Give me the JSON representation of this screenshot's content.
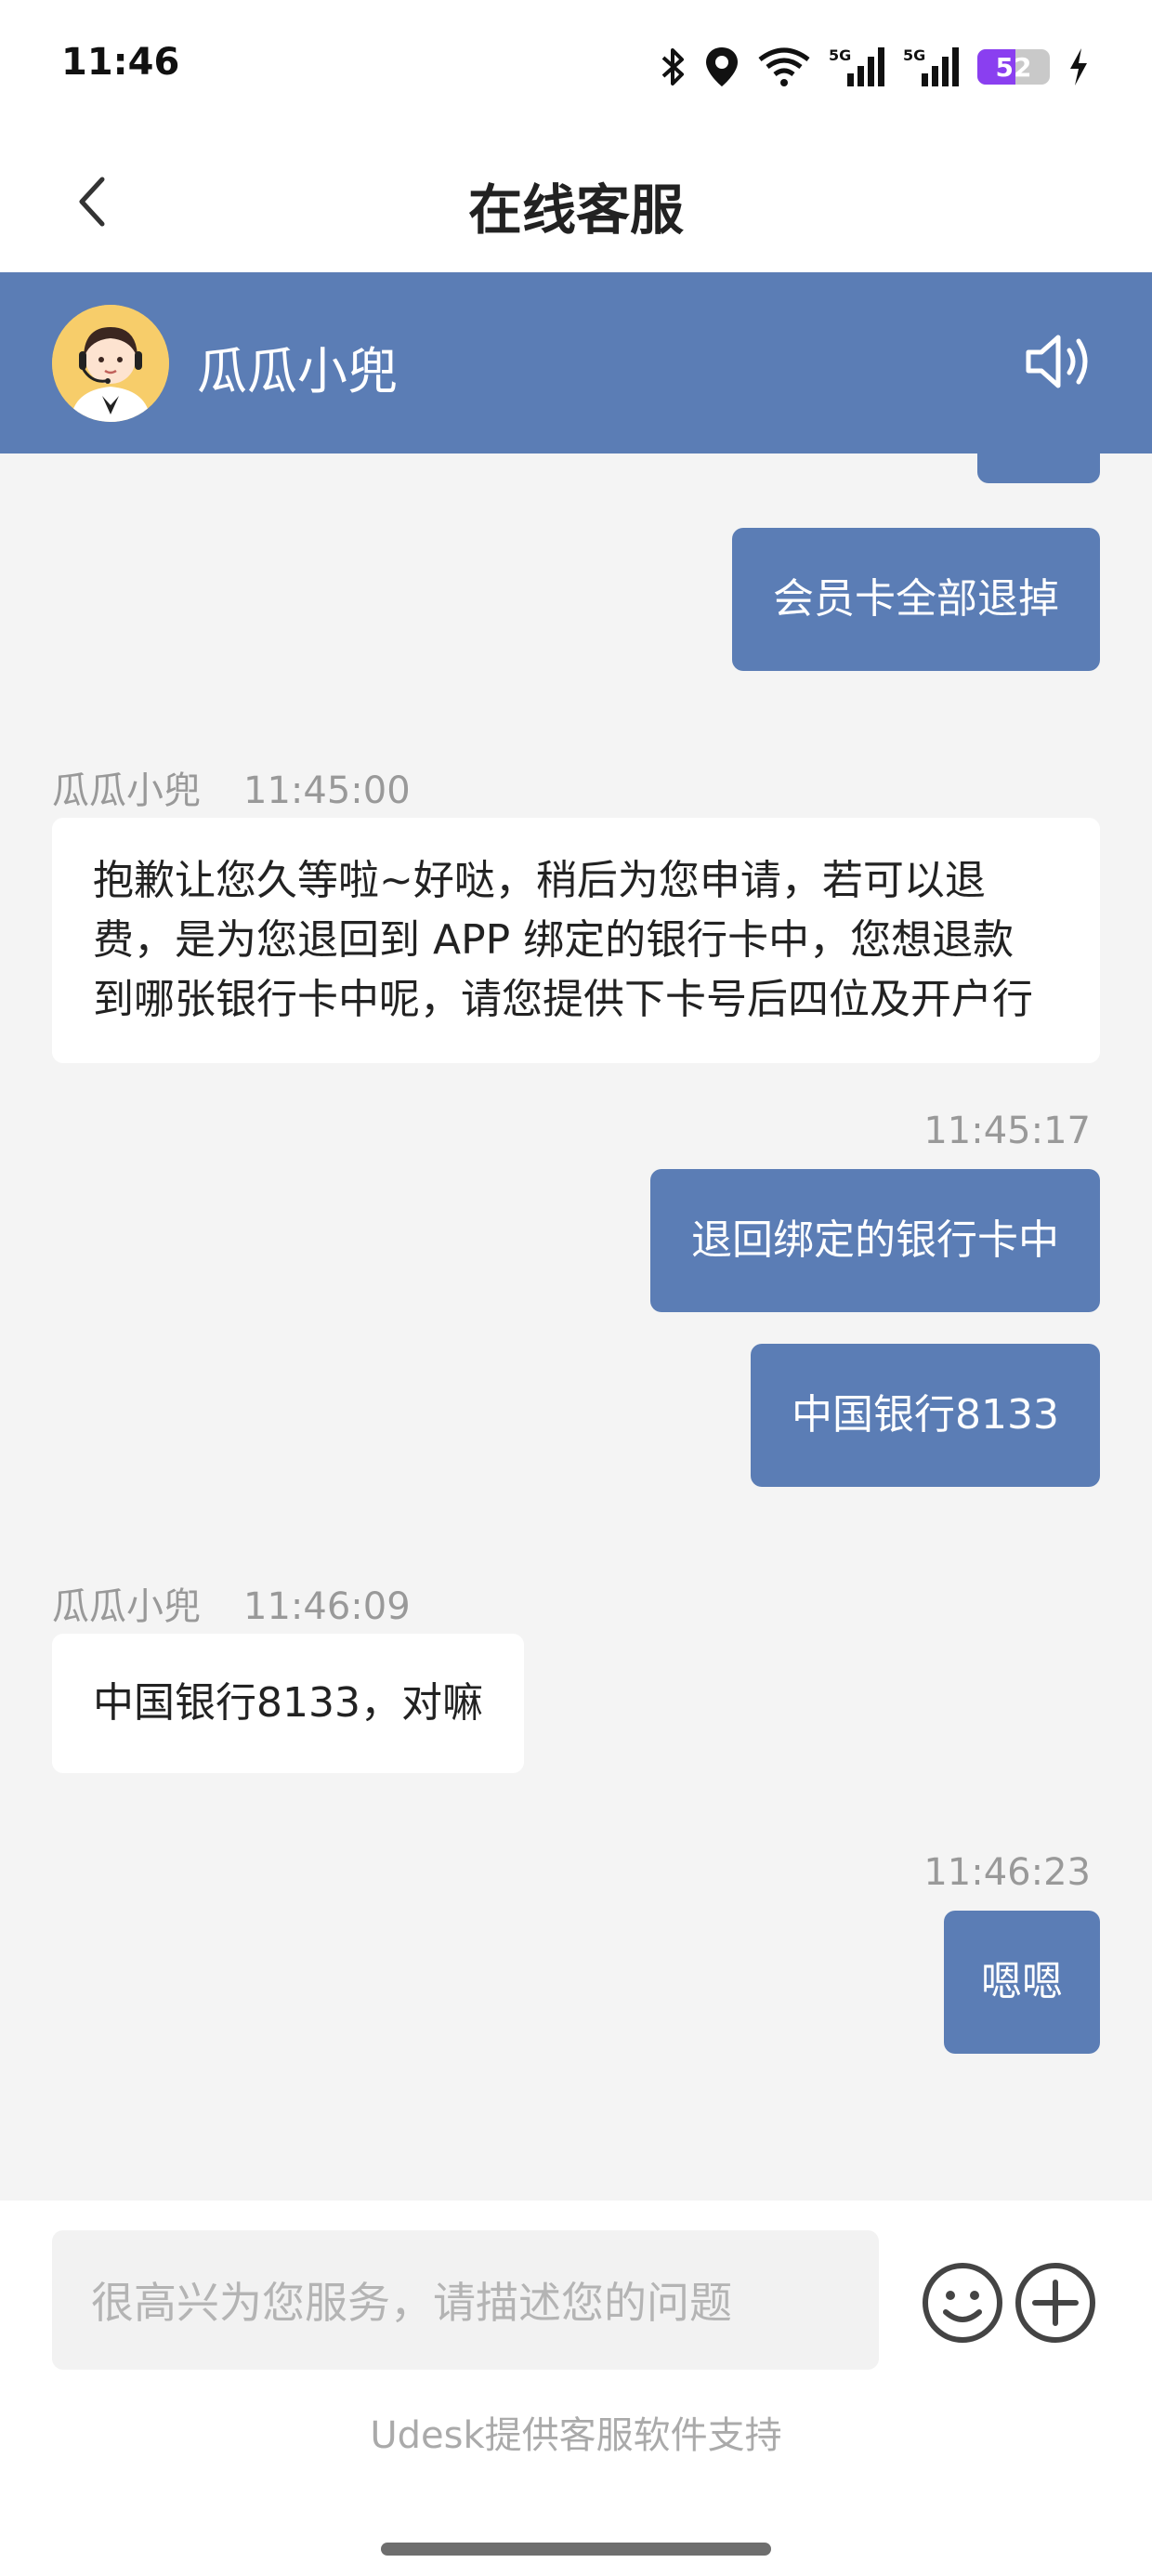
{
  "status_bar": {
    "time": "11:46",
    "battery_level": "52",
    "battery_fraction": 0.52,
    "icons": [
      "bluetooth-icon",
      "location-icon",
      "wifi-icon",
      "signal-5g-icon",
      "signal-5g-icon",
      "battery-icon",
      "charging-icon"
    ],
    "accent": "#8a3ff0"
  },
  "header": {
    "title": "在线客服",
    "back_icon": "chevron-left-icon"
  },
  "agent_bar": {
    "name": "瓜瓜小兜",
    "color": "#5b7db5",
    "speaker_icon": "speaker-icon"
  },
  "messages": [
    {
      "type": "outgoing",
      "text": "会员卡全部退掉"
    },
    {
      "type": "incoming",
      "sender": "瓜瓜小兜",
      "time": "11:45:00",
      "lines": [
        "抱歉让您久等啦~好哒，稍后为您申请，若可以退",
        "费，是为您退回到 APP 绑定的银行卡中，您想退款",
        "到哪张银行卡中呢，请您提供下卡号后四位及开户行"
      ]
    },
    {
      "type": "outgoing",
      "time": "11:45:17",
      "text": "退回绑定的银行卡中"
    },
    {
      "type": "outgoing",
      "text": "中国银行8133"
    },
    {
      "type": "incoming",
      "sender": "瓜瓜小兜",
      "time": "11:46:09",
      "text": "中国银行8133，对嘛"
    },
    {
      "type": "outgoing",
      "time": "11:46:23",
      "text": "嗯嗯"
    }
  ],
  "composer": {
    "placeholder": "很高兴为您服务，请描述您的问题",
    "emoji_icon": "emoji-icon",
    "plus_icon": "plus-circle-icon"
  },
  "footer": {
    "powered_by": "Udesk提供客服软件支持"
  }
}
